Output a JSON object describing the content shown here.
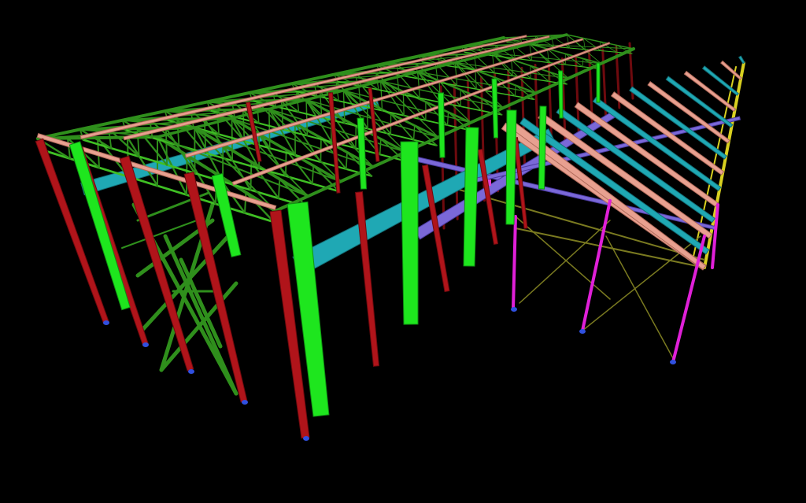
{
  "palette": {
    "background": "#000000",
    "column_red": "#b0141a",
    "column_red_edge": "#6e0a0e",
    "column_green": "#1ee61e",
    "column_green_edge": "#0f8f12",
    "column_magenta": "#e020d8",
    "truss_green": "#2f8f1c",
    "truss_green_light": "#3fbf24",
    "purlin_pink": "#e8a090",
    "purlin_pink_edge": "#b06a5a",
    "beam_cyan": "#1fa8b4",
    "beam_cyan_edge": "#137078",
    "beam_purple": "#7a68d8",
    "beam_purple_edge": "#4a3aa0",
    "brace_olive": "#7a7a20",
    "brace_yellow": "#d8d020",
    "base_plate_blue": "#3050e0",
    "connection_pink": "#e040d0"
  },
  "elements": {
    "structure_label": "steel-frame-3d-model"
  }
}
